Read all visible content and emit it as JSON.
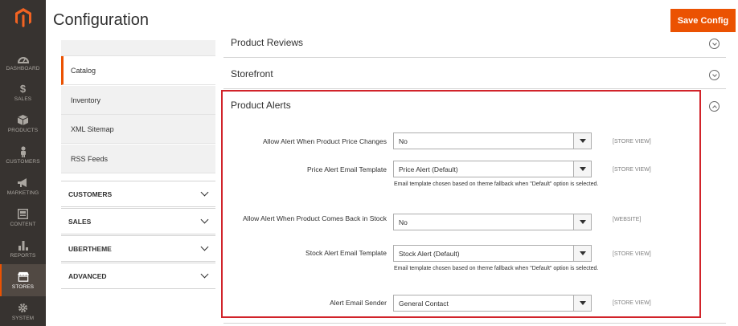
{
  "header": {
    "title": "Configuration",
    "save_label": "Save Config"
  },
  "adminnav": {
    "items": [
      {
        "label": "DASHBOARD",
        "icon": "dashboard-icon"
      },
      {
        "label": "SALES",
        "icon": "dollar-icon"
      },
      {
        "label": "PRODUCTS",
        "icon": "box-icon"
      },
      {
        "label": "CUSTOMERS",
        "icon": "person-icon"
      },
      {
        "label": "MARKETING",
        "icon": "megaphone-icon"
      },
      {
        "label": "CONTENT",
        "icon": "content-icon"
      },
      {
        "label": "REPORTS",
        "icon": "bar-chart-icon"
      },
      {
        "label": "STORES",
        "icon": "store-icon"
      },
      {
        "label": "SYSTEM",
        "icon": "gear-icon"
      }
    ]
  },
  "sidebar": {
    "links": [
      "Catalog",
      "Inventory",
      "XML Sitemap",
      "RSS Feeds"
    ],
    "sections": [
      "CUSTOMERS",
      "SALES",
      "UBERTHEME",
      "ADVANCED"
    ]
  },
  "sections": {
    "reviews": "Product Reviews",
    "storefront": "Storefront",
    "alerts": "Product Alerts"
  },
  "fields": [
    {
      "label": "Allow Alert When Product Price Changes",
      "value": "No",
      "scope": "[STORE VIEW]"
    },
    {
      "label": "Price Alert Email Template",
      "value": "Price Alert (Default)",
      "scope": "[STORE VIEW]",
      "note": "Email template chosen based on theme fallback when \"Default\" option is selected."
    },
    {
      "label": "Allow Alert When Product Comes Back in Stock",
      "value": "No",
      "scope": "[WEBSITE]"
    },
    {
      "label": "Stock Alert Email Template",
      "value": "Stock Alert (Default)",
      "scope": "[STORE VIEW]",
      "note": "Email template chosen based on theme fallback when \"Default\" option is selected."
    },
    {
      "label": "Alert Email Sender",
      "value": "General Contact",
      "scope": "[STORE VIEW]"
    }
  ],
  "colors": {
    "accent": "#eb5202",
    "nav_bg": "#373330",
    "highlight": "#d1232a"
  }
}
